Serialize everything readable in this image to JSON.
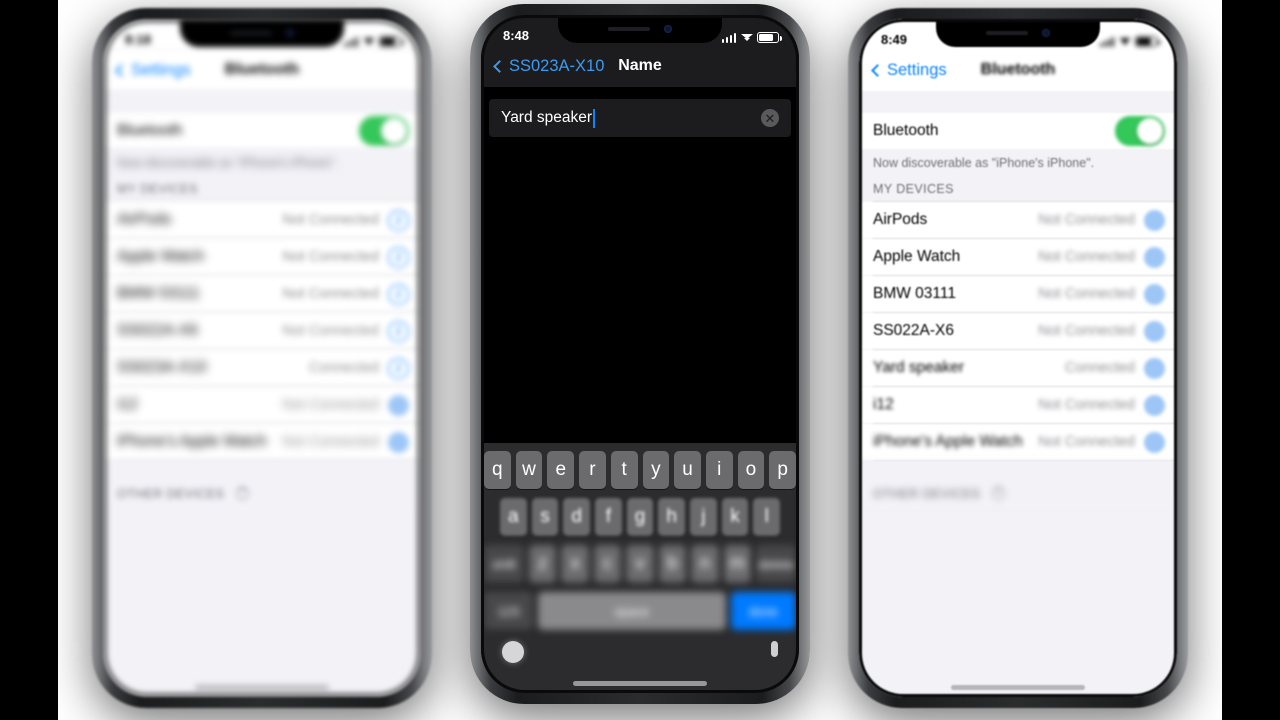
{
  "phones": {
    "left": {
      "status": {
        "time": "8:18",
        "signal_icon": "signal-bars-icon",
        "wifi_icon": "wifi-icon",
        "battery_icon": "battery-icon"
      },
      "nav": {
        "back_label": "Settings",
        "title": "Bluetooth"
      },
      "bluetooth_row": {
        "label": "Bluetooth",
        "toggle_state": "on"
      },
      "discoverable_text": "Now discoverable as \"iPhone's iPhone\".",
      "section_header": "MY DEVICES",
      "devices": [
        {
          "name": "AirPods",
          "status": "Not Connected"
        },
        {
          "name": "Apple Watch",
          "status": "Not Connected"
        },
        {
          "name": "BMW 03111",
          "status": "Not Connected"
        },
        {
          "name": "SS022A-X6",
          "status": "Not Connected"
        },
        {
          "name": "SS023A-X10",
          "status": "Connected"
        },
        {
          "name": "i12",
          "status": "Not Connected"
        },
        {
          "name": "iPhone's Apple Watch",
          "status": "Not Connected"
        }
      ],
      "other_header": "OTHER DEVICES"
    },
    "mid": {
      "status": {
        "time": "8:48",
        "signal_icon": "signal-bars-icon",
        "wifi_icon": "wifi-icon",
        "battery_icon": "battery-icon"
      },
      "nav": {
        "back_label": "SS023A-X10",
        "title": "Name"
      },
      "name_field": {
        "value": "Yard speaker",
        "clear_icon": "clear-circle-icon"
      },
      "keyboard": {
        "row1": [
          "q",
          "w",
          "e",
          "r",
          "t",
          "y",
          "u",
          "i",
          "o",
          "p"
        ],
        "row2": [
          "a",
          "s",
          "d",
          "f",
          "g",
          "h",
          "j",
          "k",
          "l"
        ],
        "row3": [
          "shift",
          "z",
          "x",
          "c",
          "v",
          "b",
          "n",
          "m",
          "delete"
        ],
        "row4": [
          "123",
          "space",
          "done"
        ],
        "globe_icon": "emoji-globe-icon",
        "mic_icon": "microphone-icon"
      }
    },
    "right": {
      "status": {
        "time": "8:49",
        "signal_icon": "signal-bars-icon",
        "wifi_icon": "wifi-icon",
        "battery_icon": "battery-icon"
      },
      "nav": {
        "back_label": "Settings",
        "title": "Bluetooth"
      },
      "bluetooth_row": {
        "label": "Bluetooth",
        "toggle_state": "on"
      },
      "discoverable_text": "Now discoverable as \"iPhone's iPhone\".",
      "section_header": "MY DEVICES",
      "devices": [
        {
          "name": "AirPods",
          "status": "Not Connected"
        },
        {
          "name": "Apple Watch",
          "status": "Not Connected"
        },
        {
          "name": "BMW 03111",
          "status": "Not Connected"
        },
        {
          "name": "SS022A-X6",
          "status": "Not Connected"
        },
        {
          "name": "Yard speaker",
          "status": "Connected"
        },
        {
          "name": "i12",
          "status": "Not Connected"
        },
        {
          "name": "iPhone's Apple Watch",
          "status": "Not Connected"
        }
      ],
      "other_header": "OTHER DEVICES"
    }
  },
  "colors": {
    "accent_blue": "#007aff",
    "toggle_green": "#34c759",
    "done_key_blue": "#007aff",
    "secondary_gray": "#8e8e93"
  }
}
